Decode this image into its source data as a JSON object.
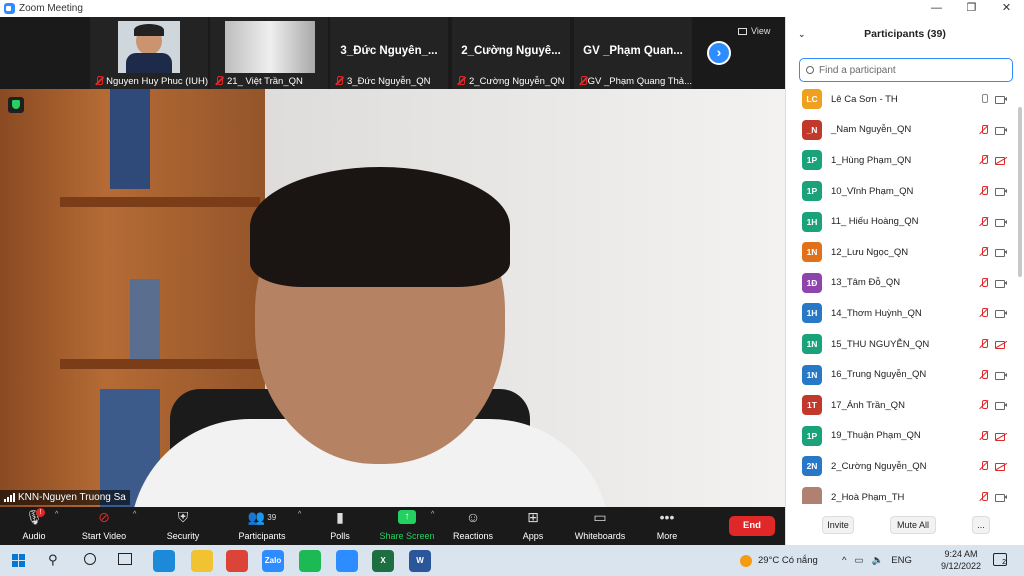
{
  "window": {
    "title": "Zoom Meeting",
    "controls": [
      "—",
      "❐",
      "✕"
    ]
  },
  "thumbnails": [
    {
      "big": "",
      "caption": "Nguyen Huy Phuc (IUH)",
      "video": true,
      "kind": "person"
    },
    {
      "big": "",
      "caption": "21_ Việt Trần_QN",
      "video": true,
      "kind": "room"
    },
    {
      "big": "3_Đức Nguyễn_...",
      "caption": "3_Đức Nguyễn_QN",
      "video": false
    },
    {
      "big": "2_Cường Nguyễ...",
      "caption": "2_Cường Nguyễn_QN",
      "video": false
    },
    {
      "big": "GV _Phạm Quan...",
      "caption": "GV _Phạm Quang Thả...",
      "video": false
    }
  ],
  "view_label": "View",
  "speaker": {
    "name": "KNN-Nguyen Truong Sa"
  },
  "toolbar": {
    "audio": "Audio",
    "audio_badge": "!",
    "start_video": "Start Video",
    "security": "Security",
    "participants": "Participants",
    "participants_count": "39",
    "polls": "Polls",
    "share_screen": "Share Screen",
    "reactions": "Reactions",
    "apps": "Apps",
    "whiteboards": "Whiteboards",
    "more": "More",
    "end": "End"
  },
  "panel": {
    "title": "Participants (39)",
    "search_placeholder": "Find a participant",
    "invite": "Invite",
    "mute_all": "Mute All",
    "more": "...",
    "participants": [
      {
        "initials": "LC",
        "name": "Lê Ca Sơn - TH",
        "color": "#f0a020",
        "mic": "on",
        "cam": "on"
      },
      {
        "initials": "_N",
        "name": "_Nam Nguyễn_QN",
        "color": "#c0392b",
        "mic": "muted",
        "cam": "on"
      },
      {
        "initials": "1P",
        "name": "1_Hùng Phạm_QN",
        "color": "#1aa37a",
        "mic": "muted",
        "cam": "off"
      },
      {
        "initials": "1P",
        "name": "10_Vĩnh Phạm_QN",
        "color": "#1aa37a",
        "mic": "muted",
        "cam": "on"
      },
      {
        "initials": "1H",
        "name": "11_ Hiếu Hoàng_QN",
        "color": "#1aa37a",
        "mic": "muted",
        "cam": "on"
      },
      {
        "initials": "1N",
        "name": "12_Lưu Ngọc_QN",
        "color": "#e0701a",
        "mic": "muted",
        "cam": "on"
      },
      {
        "initials": "1Đ",
        "name": "13_Tâm Đỗ_QN",
        "color": "#8e44ad",
        "mic": "muted",
        "cam": "on"
      },
      {
        "initials": "1H",
        "name": "14_Thơm Huỳnh_QN",
        "color": "#2878c8",
        "mic": "muted",
        "cam": "on"
      },
      {
        "initials": "1N",
        "name": "15_THU NGUYỄN_QN",
        "color": "#1aa37a",
        "mic": "muted",
        "cam": "off"
      },
      {
        "initials": "1N",
        "name": "16_Trung Nguyễn_QN",
        "color": "#2878c8",
        "mic": "muted",
        "cam": "on"
      },
      {
        "initials": "1T",
        "name": "17_Ánh Trần_QN",
        "color": "#c0392b",
        "mic": "muted",
        "cam": "on"
      },
      {
        "initials": "1P",
        "name": "19_Thuận Phạm_QN",
        "color": "#1aa37a",
        "mic": "muted",
        "cam": "off"
      },
      {
        "initials": "2N",
        "name": "2_Cường Nguyễn_QN",
        "color": "#2878c8",
        "mic": "muted",
        "cam": "off"
      },
      {
        "initials": "",
        "name": "2_Hoà Phạm_TH",
        "color": "#b08070",
        "mic": "muted",
        "cam": "on"
      }
    ]
  },
  "taskbar": {
    "weather": "29°C  Có nắng",
    "lang": "ENG",
    "time": "9:24 AM",
    "date": "9/12/2022",
    "notif": "2",
    "apps": [
      {
        "name": "edge-icon",
        "color": "#1c8ad8"
      },
      {
        "name": "explorer-icon",
        "color": "#f1c232"
      },
      {
        "name": "chrome-icon",
        "color": "#db4437"
      },
      {
        "name": "zalo-icon",
        "color": "#2d8cff",
        "label": "Zalo"
      },
      {
        "name": "spotify-icon",
        "color": "#1db954"
      },
      {
        "name": "zoom-icon",
        "color": "#2d8cff"
      },
      {
        "name": "excel-icon",
        "color": "#1d6f42",
        "label": "X"
      },
      {
        "name": "word-icon",
        "color": "#2b579a",
        "label": "W"
      }
    ]
  }
}
